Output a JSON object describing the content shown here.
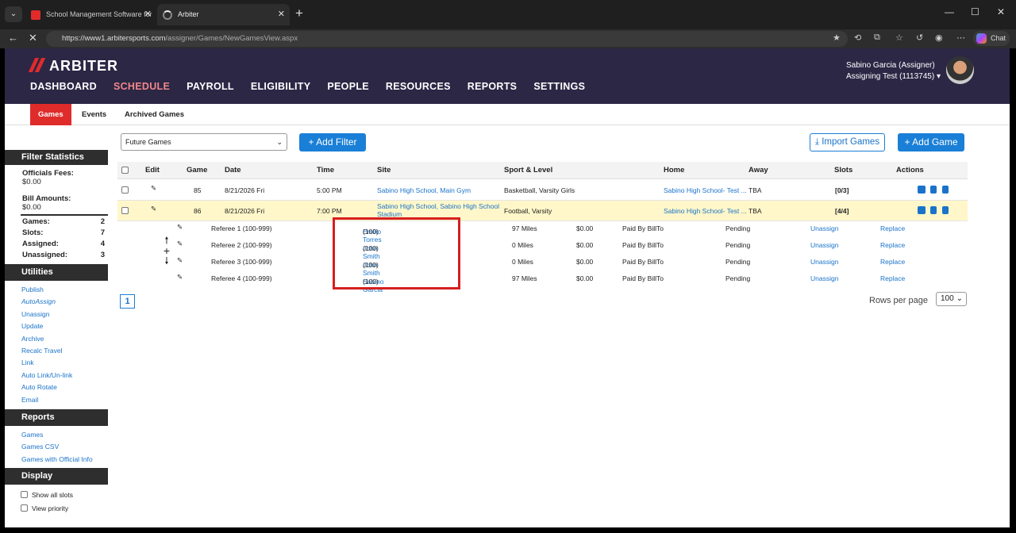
{
  "browser": {
    "tabs": [
      {
        "title": "School Management Software for"
      },
      {
        "title": "Arbiter"
      }
    ],
    "url_host": "https://www1.arbitersports.com",
    "url_path": "/assigner/Games/NewGamesView.aspx",
    "chat_label": "Chat"
  },
  "header": {
    "brand": "ARBITER",
    "nav": [
      "DASHBOARD",
      "SCHEDULE",
      "PAYROLL",
      "ELIGIBILITY",
      "PEOPLE",
      "RESOURCES",
      "REPORTS",
      "SETTINGS"
    ],
    "active_nav": "SCHEDULE",
    "user_name": "Sabino Garcia (Assigner)",
    "user_account": "Assigning Test (1113745)"
  },
  "subnav": {
    "games": "Games",
    "events": "Events",
    "archived": "Archived Games"
  },
  "sidebar": {
    "filter_title": "Filter Statistics",
    "officials_fees_label": "Officials Fees:",
    "officials_fees_value": "$0.00",
    "bill_amounts_label": "Bill Amounts:",
    "bill_amounts_value": "$0.00",
    "stats": [
      {
        "label": "Games:",
        "value": "2"
      },
      {
        "label": "Slots:",
        "value": "7"
      },
      {
        "label": "Assigned:",
        "value": "4"
      },
      {
        "label": "Unassigned:",
        "value": "3"
      }
    ],
    "utilities_title": "Utilities",
    "utilities": [
      "Publish",
      "AutoAssign",
      "Unassign",
      "Update",
      "Archive",
      "Recalc Travel",
      "Link",
      "Auto Link/Un-link",
      "Auto Rotate",
      "Email"
    ],
    "reports_title": "Reports",
    "reports": [
      "Games",
      "Games CSV",
      "Games with Official Info"
    ],
    "display_title": "Display",
    "display": [
      "Show all slots",
      "View priority"
    ]
  },
  "toolbar": {
    "filter_select": "Future Games",
    "add_filter": "+ Add Filter",
    "import_games": "Import Games",
    "add_game": "+ Add Game"
  },
  "table": {
    "headers": {
      "edit": "Edit",
      "game": "Game",
      "date": "Date",
      "time": "Time",
      "site": "Site",
      "sport": "Sport & Level",
      "home": "Home",
      "away": "Away",
      "slots": "Slots",
      "actions": "Actions"
    },
    "rows": [
      {
        "game": "85",
        "date": "8/21/2026 Fri",
        "time": "5:00 PM",
        "site": "Sabino High School, Main Gym",
        "site2": "",
        "sport": "Basketball, Varsity Girls",
        "home": "Sabino High School- Test ...",
        "away": "TBA",
        "slots": "[0/3]"
      },
      {
        "game": "86",
        "date": "8/21/2026 Fri",
        "time": "7:00 PM",
        "site": "Sabino High School, Sabino High School",
        "site2": "Stadium",
        "sport": "Football, Varsity",
        "home": "Sabino High School- Test ...",
        "away": "TBA",
        "slots": "[4/4]"
      }
    ],
    "officials": [
      {
        "position": "Referee 1 (100-999)",
        "name": "Emilio Torres",
        "id": "(100)",
        "miles": "97 Miles",
        "fee": "$0.00",
        "paid": "Paid By BillTo",
        "status": "Pending",
        "unassign": "Unassign",
        "replace": "Replace"
      },
      {
        "position": "Referee 2 (100-999)",
        "name": "John Smith",
        "id": "(100)",
        "miles": "0 Miles",
        "fee": "$0.00",
        "paid": "Paid By BillTo",
        "status": "Pending",
        "unassign": "Unassign",
        "replace": "Replace"
      },
      {
        "position": "Referee 3 (100-999)",
        "name": "John Smith",
        "id": "(100)",
        "miles": "0 Miles",
        "fee": "$0.00",
        "paid": "Paid By BillTo",
        "status": "Pending",
        "unassign": "Unassign",
        "replace": "Replace"
      },
      {
        "position": "Referee 4 (100-999)",
        "name": "Sabino Garcia",
        "id": "(100)",
        "miles": "97 Miles",
        "fee": "$0.00",
        "paid": "Paid By BillTo",
        "status": "Pending",
        "unassign": "Unassign",
        "replace": "Replace"
      }
    ]
  },
  "pagination": {
    "page": "1",
    "rows_per_page_label": "Rows per page",
    "rows_per_page": "100"
  },
  "colors": {
    "header_bg": "#2b2745",
    "accent_red": "#e02b2b",
    "link_blue": "#1a73c9",
    "button_blue": "#1a7fd6",
    "selected_row": "#fff7c9"
  }
}
